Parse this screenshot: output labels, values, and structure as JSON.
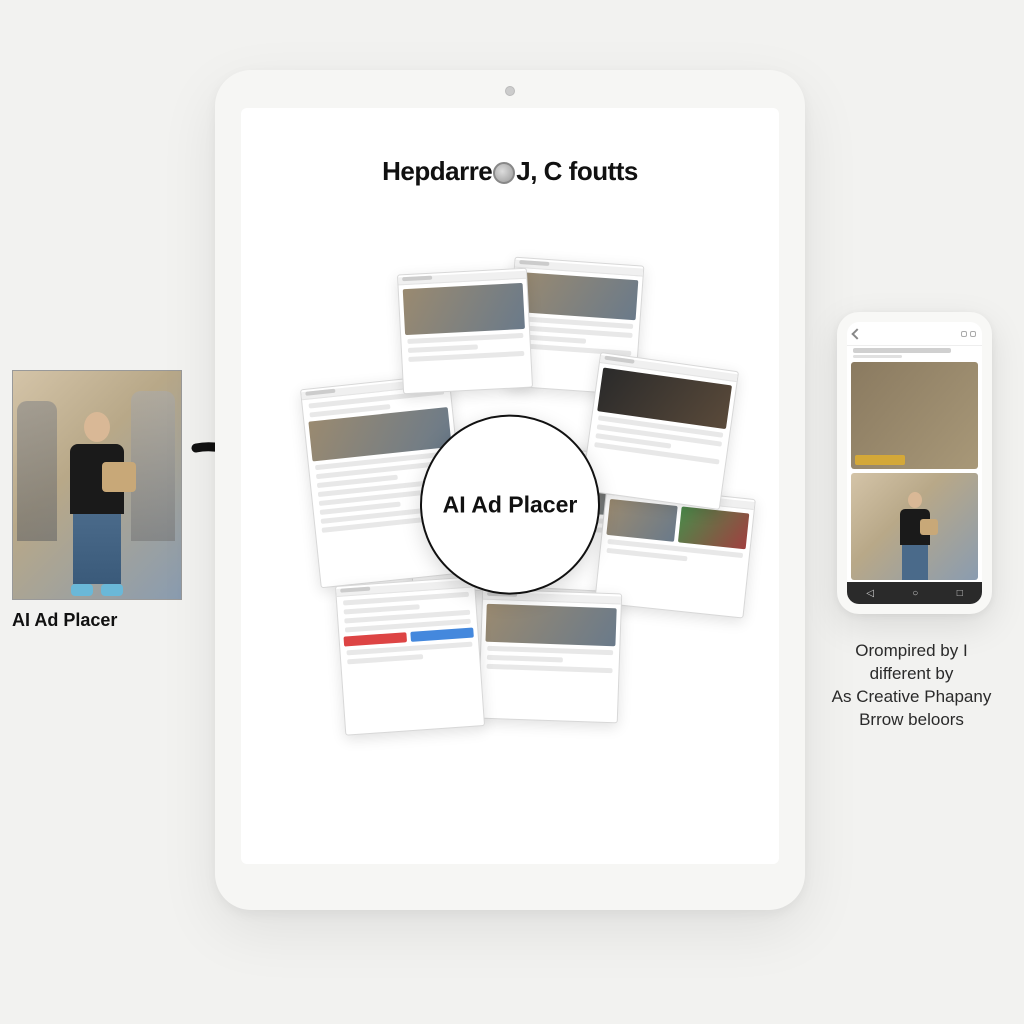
{
  "source": {
    "label": "AI Ad Placer"
  },
  "tablet": {
    "title_left": "Hepdarre",
    "title_right": "J, C foutts"
  },
  "center_badge": {
    "label": "AI Ad Placer"
  },
  "phone": {
    "caption_line1": "Orompired by I",
    "caption_line2": "different by",
    "caption_line3": "As Creative Phapany",
    "caption_line4": "Brrow beloors"
  }
}
